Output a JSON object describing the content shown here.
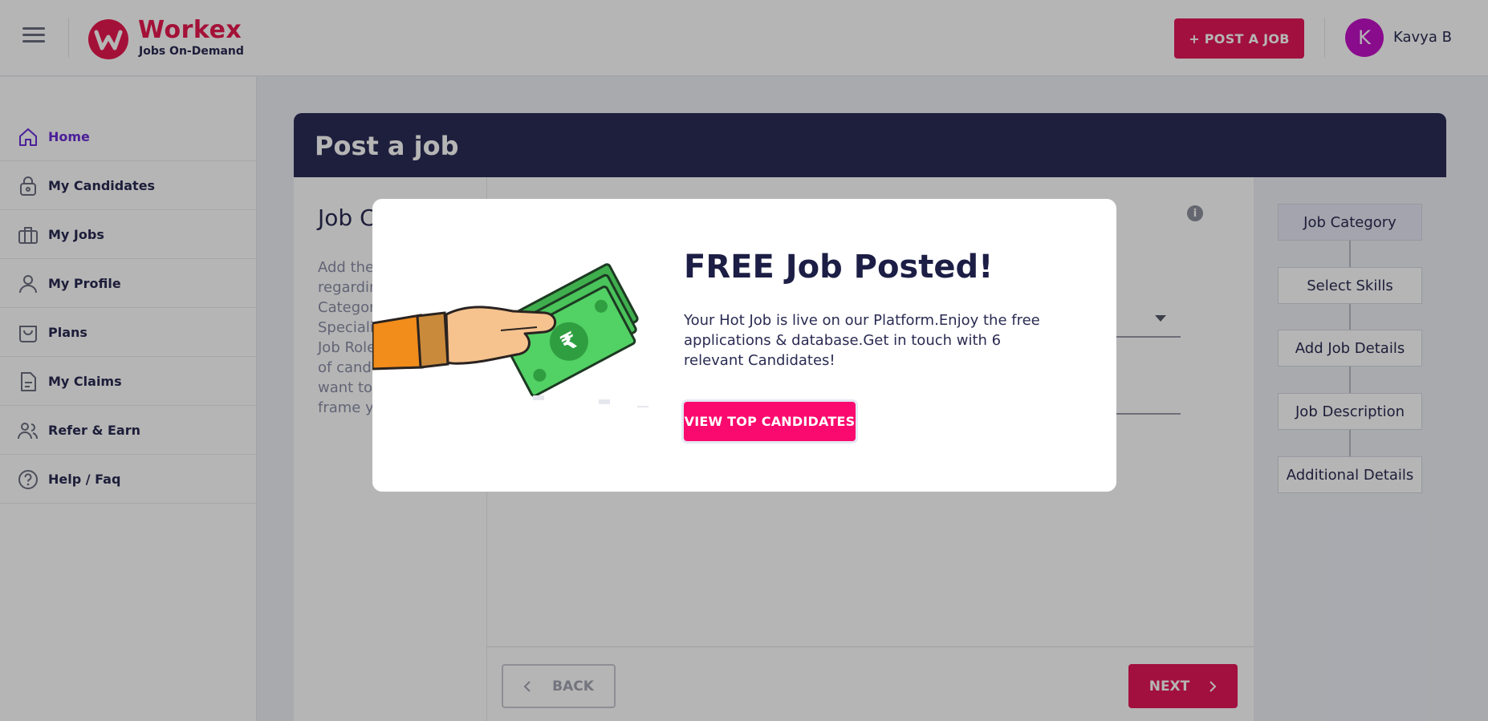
{
  "header": {
    "brand": {
      "name": "Workex",
      "tagline": "Jobs On-Demand"
    },
    "post_job_label": "+ POST A JOB",
    "user": {
      "initial": "K",
      "name": "Kavya B"
    }
  },
  "sidebar": {
    "items": [
      {
        "label": "Home",
        "icon": "home-icon",
        "active": true
      },
      {
        "label": "My Candidates",
        "icon": "lock-bag-icon"
      },
      {
        "label": "My Jobs",
        "icon": "briefcase-icon"
      },
      {
        "label": "My Profile",
        "icon": "person-icon"
      },
      {
        "label": "Plans",
        "icon": "shopping-bag-icon"
      },
      {
        "label": "My Claims",
        "icon": "document-icon"
      },
      {
        "label": "Refer & Earn",
        "icon": "people-icon"
      },
      {
        "label": "Help / Faq",
        "icon": "help-icon"
      }
    ]
  },
  "page": {
    "title": "Post a job",
    "left_title": "Job C",
    "left_desc": "Add the\nregardin\nCategor\nSpeciali\nJob Role\nof candi\nwant to\nframe y",
    "back_label": "BACK",
    "next_label": "NEXT",
    "steps": [
      "Job Category",
      "Select Skills",
      "Add Job Details",
      "Job Description",
      "Additional Details"
    ]
  },
  "modal": {
    "title": "FREE Job Posted!",
    "message": "Your Hot Job is live on our Platform.Enjoy the free applications & database.Get in touch with 6 relevant Candidates!",
    "cta_label": "VIEW TOP CANDIDATES"
  },
  "colors": {
    "brand": "#e8194f",
    "primary_button": "#e4175a",
    "cta": "#fa0a6e",
    "navy": "#2b2c56",
    "active_nav": "#6a2cd8",
    "avatar": "#c211c7"
  }
}
